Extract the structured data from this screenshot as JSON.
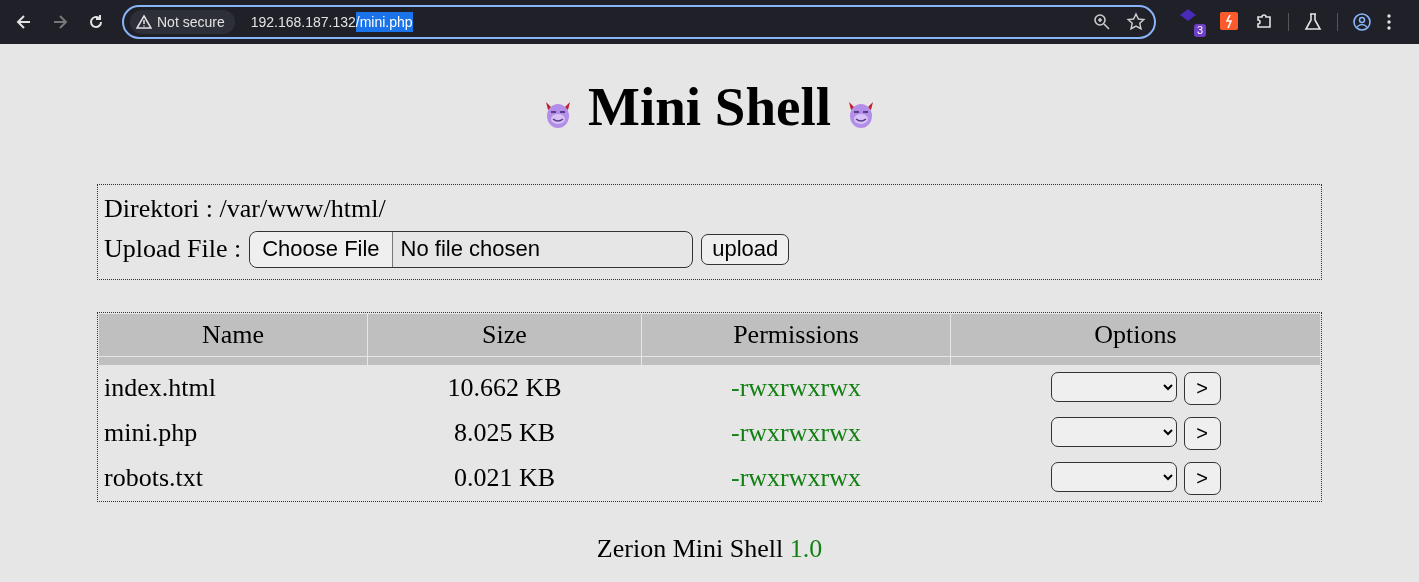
{
  "browser": {
    "security": "Not secure",
    "url_parts": [
      {
        "text": "192.168.187.132",
        "selected": false
      },
      {
        "text": "/mini.php",
        "selected": true
      }
    ],
    "extension_badge": "3"
  },
  "title": "Mini Shell",
  "directory": {
    "label": "Direktori :",
    "path": "/var/www/html/"
  },
  "upload": {
    "label": "Upload File :",
    "choose_button": "Choose File",
    "file_status": "No file chosen",
    "submit": "upload"
  },
  "table": {
    "columns": [
      "Name",
      "Size",
      "Permissions",
      "Options"
    ],
    "rows": [
      {
        "name": "index.html",
        "size": "10.662 KB",
        "permissions": "-rwxrwxrwx",
        "go": ">"
      },
      {
        "name": "mini.php",
        "size": "8.025 KB",
        "permissions": "-rwxrwxrwx",
        "go": ">"
      },
      {
        "name": "robots.txt",
        "size": "0.021 KB",
        "permissions": "-rwxrwxrwx",
        "go": ">"
      }
    ]
  },
  "footer": {
    "text": "Zerion Mini Shell",
    "version": "1.0"
  }
}
